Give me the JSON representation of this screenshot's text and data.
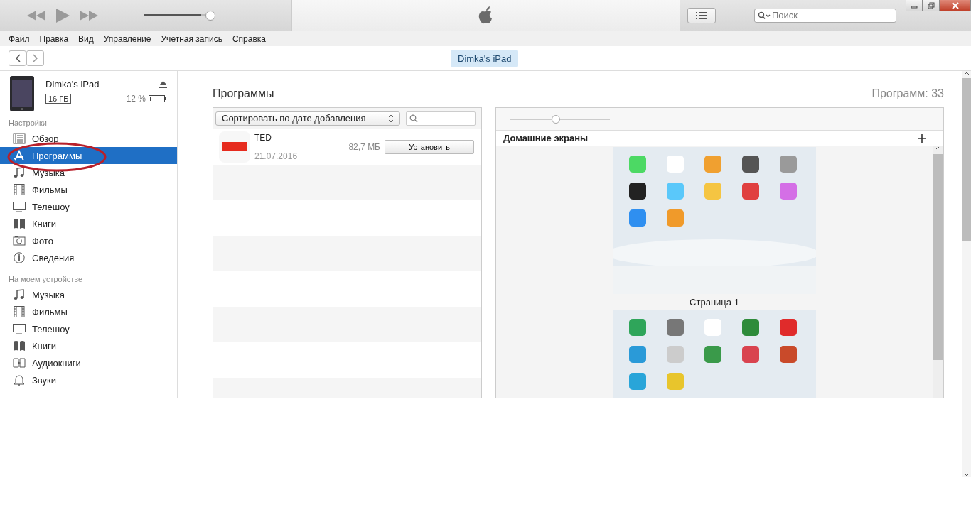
{
  "player": {
    "volume": {
      "level": 0.9
    }
  },
  "search": {
    "placeholder": "Поиск"
  },
  "menu": [
    "Файл",
    "Правка",
    "Вид",
    "Управление",
    "Учетная запись",
    "Справка"
  ],
  "device_tab": "Dimka's iPad",
  "device": {
    "name": "Dimka's iPad",
    "capacity": "16 ГБ",
    "battery": "12 %"
  },
  "sidebar": [
    {
      "heading": "Настройки",
      "items": [
        {
          "label": "Обзор",
          "kind": "summary",
          "selected": false
        },
        {
          "label": "Программы",
          "kind": "apps",
          "selected": true
        },
        {
          "label": "Музыка",
          "kind": "music",
          "selected": false
        },
        {
          "label": "Фильмы",
          "kind": "film",
          "selected": false
        },
        {
          "label": "Телешоу",
          "kind": "tv",
          "selected": false
        },
        {
          "label": "Книги",
          "kind": "books",
          "selected": false
        },
        {
          "label": "Фото",
          "selected": false
        },
        {
          "label": "Сведения",
          "kind": "info",
          "selected": false
        }
      ]
    },
    {
      "heading": "На моем устройстве",
      "items": [
        {
          "label": "Музыка",
          "kind": "music",
          "selected": false
        },
        {
          "label": "Фильмы",
          "kind": "film",
          "selected": false
        },
        {
          "label": "Телешоу",
          "kind": "tv",
          "selected": false
        },
        {
          "label": "Книги",
          "kind": "books",
          "selected": false
        },
        {
          "label": "Аудиокниги",
          "kind": "audiobook",
          "selected": false
        },
        {
          "label": "Звуки",
          "kind": "bell",
          "selected": false
        }
      ]
    }
  ],
  "main": {
    "title": "Программы",
    "count": "Программ: 33"
  },
  "apps": {
    "sort": "Сортировать по дате добавления",
    "rows": [
      {
        "name": "TED",
        "date": "21.07.2016",
        "size": "82,7 МБ",
        "action": "Установить"
      }
    ]
  },
  "home_screens": {
    "title": "Домашние экраны",
    "zoom": {
      "level": 0.46
    },
    "pages": [
      {
        "kind": "picture",
        "label": "Страница 1"
      },
      {
        "kind": "picture"
      }
    ]
  }
}
